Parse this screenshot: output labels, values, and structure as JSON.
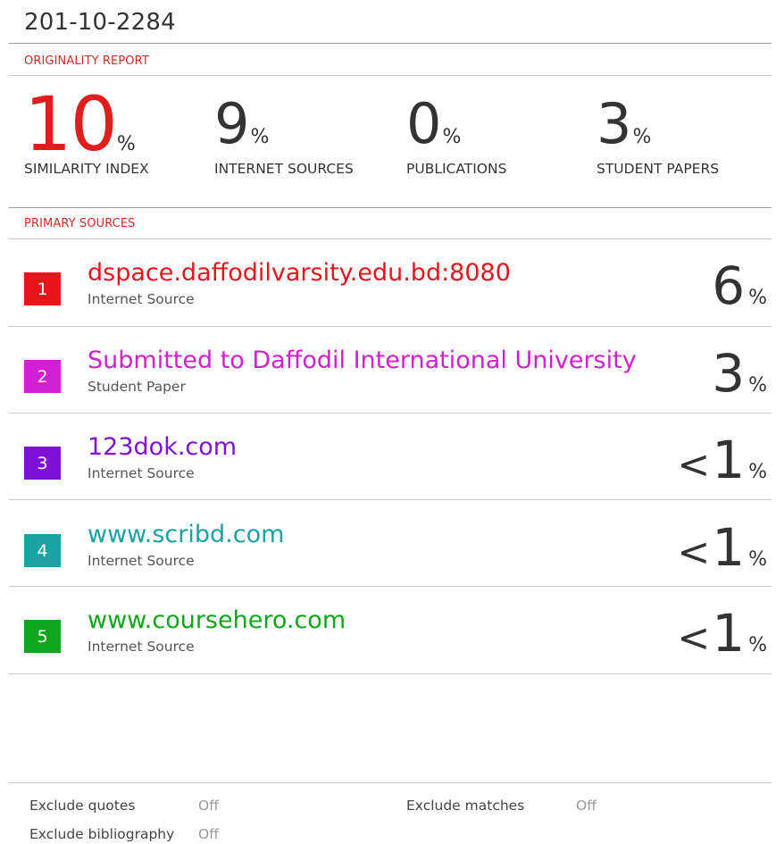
{
  "document_title": "201-10-2284",
  "originality_report_label": "ORIGINALITY REPORT",
  "stats": [
    {
      "value": "10",
      "unit": "%",
      "caption": "SIMILARITY INDEX"
    },
    {
      "value": "9",
      "unit": "%",
      "caption": "INTERNET SOURCES"
    },
    {
      "value": "0",
      "unit": "%",
      "caption": "PUBLICATIONS"
    },
    {
      "value": "3",
      "unit": "%",
      "caption": "STUDENT PAPERS"
    }
  ],
  "primary_sources_label": "PRIMARY SOURCES",
  "sources": [
    {
      "index": "1",
      "title": "dspace.daffodilvarsity.edu.bd:8080",
      "type": "Internet Source",
      "prefix": "",
      "value": "6",
      "unit": "%",
      "color": "#e8131b"
    },
    {
      "index": "2",
      "title": "Submitted to Daffodil International University",
      "type": "Student Paper",
      "prefix": "",
      "value": "3",
      "unit": "%",
      "color": "#d21fcf"
    },
    {
      "index": "3",
      "title": "123dok.com",
      "type": "Internet Source",
      "prefix": "<",
      "value": "1",
      "unit": "%",
      "color": "#7e10d8"
    },
    {
      "index": "4",
      "title": "www.scribd.com",
      "type": "Internet Source",
      "prefix": "<",
      "value": "1",
      "unit": "%",
      "color": "#1ba3a3"
    },
    {
      "index": "5",
      "title": "www.coursehero.com",
      "type": "Internet Source",
      "prefix": "<",
      "value": "1",
      "unit": "%",
      "color": "#10a51d"
    }
  ],
  "footer": {
    "exclude_quotes_label": "Exclude quotes",
    "exclude_quotes_value": "Off",
    "exclude_bibliography_label": "Exclude bibliography",
    "exclude_bibliography_value": "Off",
    "exclude_matches_label": "Exclude matches",
    "exclude_matches_value": "Off"
  }
}
